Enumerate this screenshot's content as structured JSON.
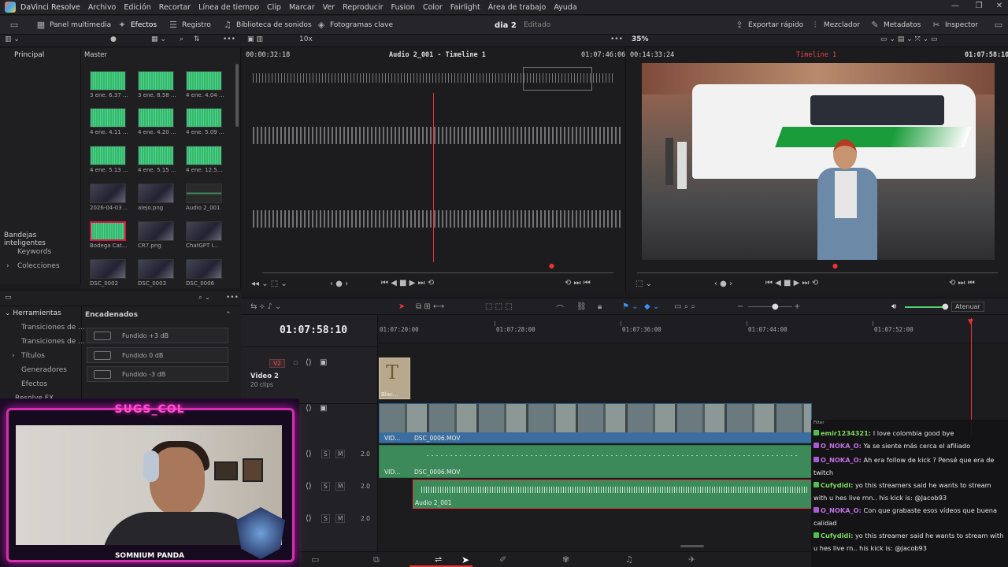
{
  "menubar": {
    "app": "DaVinci Resolve",
    "items": [
      "Archivo",
      "Edición",
      "Recortar",
      "Línea de tiempo",
      "Clip",
      "Marcar",
      "Ver",
      "Reproducir",
      "Fusion",
      "Color",
      "Fairlight",
      "Área de trabajo",
      "Ayuda"
    ]
  },
  "toolbar": {
    "media": "Panel multimedia",
    "effects": "Efectos",
    "index": "Registro",
    "sound": "Biblioteca de sonidos",
    "keyframes": "Fotogramas clave",
    "project": "dia 2",
    "status": "Editado",
    "quick_export": "Exportar rápido",
    "mixer": "Mezclador",
    "metadata": "Metadatos",
    "inspector": "Inspector"
  },
  "subbar": {
    "zoom_src": "10x",
    "zoom_prog": "35%"
  },
  "leftpanel": {
    "main": "Principal",
    "smart_bins": "Bandejas inteligentes",
    "keywords": "Keywords",
    "collections": "Colecciones"
  },
  "pool": {
    "title": "Master",
    "clips": [
      {
        "label": "3 ene. 6.37 ...",
        "kind": "wav"
      },
      {
        "label": "3 ene. 8.58 ...",
        "kind": "wav"
      },
      {
        "label": "4 ene. 4.04 ...",
        "kind": "wav"
      },
      {
        "label": "4 ene. 4.11 ...",
        "kind": "wav"
      },
      {
        "label": "4 ene. 4.20 ...",
        "kind": "wav"
      },
      {
        "label": "4 ene. 5.09 ...",
        "kind": "wav"
      },
      {
        "label": "4 ene. 5.13 ...",
        "kind": "wav"
      },
      {
        "label": "4 ene. 5.15 ...",
        "kind": "wav"
      },
      {
        "label": "4 ene. 12.5...",
        "kind": "wav"
      },
      {
        "label": "2026-04-03 ...",
        "kind": "img"
      },
      {
        "label": "alejo.png",
        "kind": "img"
      },
      {
        "label": "Audio 2_001",
        "kind": "audio"
      },
      {
        "label": "Bodega Cat...",
        "kind": "sel"
      },
      {
        "label": "CR7.png",
        "kind": "img"
      },
      {
        "label": "ChatGPT I...",
        "kind": "img"
      },
      {
        "label": "DSC_0002",
        "kind": "img"
      },
      {
        "label": "DSC_0003",
        "kind": "img"
      },
      {
        "label": "DSC_0006",
        "kind": "img"
      }
    ]
  },
  "source": {
    "tc_left": "00:00:32:18",
    "name": "Audio 2_001 - Timeline 1",
    "tc_right": "01:07:46:06"
  },
  "program": {
    "tc_left": "00:14:33:24",
    "name": "Timeline 1",
    "tc_right": "01:07:58:10"
  },
  "tools": {
    "header": "Herramientas",
    "items": [
      "Transiciones de ...",
      "Transiciones de ...",
      "Títulos",
      "Generadores",
      "Efectos",
      "Resolve FX"
    ],
    "chained": "Encadenados",
    "fx": [
      "Fundido +3 dB",
      "Fundido 0 dB",
      "Fundido -3 dB"
    ]
  },
  "timeline": {
    "timecode": "01:07:58:10",
    "ruler": [
      "01:07:20:00",
      "01:07:28:00",
      "01:07:36:00",
      "01:07:44:00",
      "01:07:52:00"
    ],
    "v2": "V2",
    "video2": "Video 2",
    "clips_count": "20 clips",
    "title_clip": "Blac...",
    "v1_clip": "DSC_0006.MOV",
    "v1_small": "VID...",
    "a1_clip": "DSC_0006.MOV",
    "a1_small": "VID...",
    "a2_clip": "Audio 2_001",
    "levels": [
      "2.0",
      "2.0",
      "2.0"
    ],
    "mute": "S",
    "solo": "M",
    "monitor": "Atenuar"
  },
  "webcam": {
    "title": "SUGS_COL",
    "nameplate": "SOMNIUM PANDA"
  },
  "chat": {
    "lines": [
      {
        "user": "emir1234321:",
        "text": " I love colombia good bye",
        "color": "#7fdc5e"
      },
      {
        "user": "O_NOKA_O:",
        "text": " Ya se siente más cerca el afiliado",
        "color": "#c06fe0"
      },
      {
        "user": "O_NOKA_O:",
        "text": " Ah era follow de kick ? Pensé que era de twitch",
        "color": "#c06fe0"
      },
      {
        "user": "Cufydidi:",
        "text": " yo this streamers said he wants to stream with u hes live rnn.. his kick is: @Jacob93",
        "color": "#7fdc5e"
      },
      {
        "user": "O_NOKA_O:",
        "text": " Con que grabaste esos vídeos que buena calidad",
        "color": "#c06fe0"
      },
      {
        "user": "Cufydidi:",
        "text": " yo this streamer said he wants to stream with u hes live rn.. his kick is: @Jacob93",
        "color": "#7fdc5e"
      }
    ],
    "filter": "Filter"
  }
}
